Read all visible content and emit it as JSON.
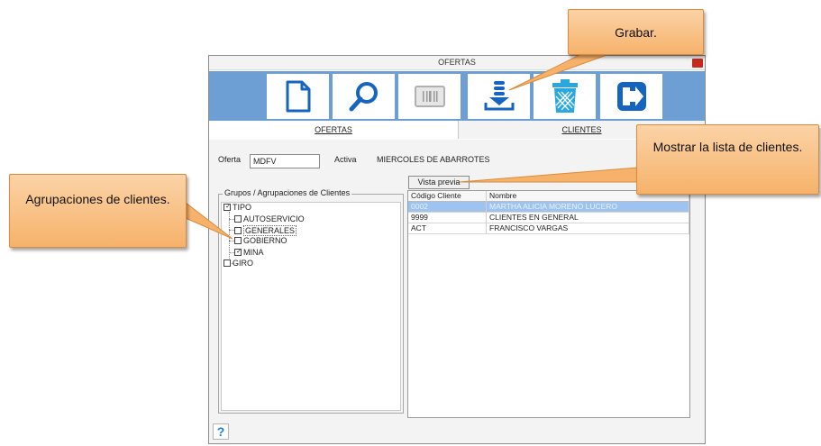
{
  "window": {
    "title": "OFERTAS"
  },
  "toolbar": {
    "buttons": [
      {
        "name": "new-document-icon"
      },
      {
        "name": "search-icon"
      },
      {
        "name": "barcode-icon"
      },
      {
        "name": "save-icon"
      },
      {
        "name": "delete-icon"
      },
      {
        "name": "exit-icon"
      }
    ]
  },
  "tabs": {
    "ofertas": "OFERTAS",
    "clientes": "CLIENTES"
  },
  "form": {
    "oferta_label": "Oferta",
    "oferta_value": "MDFV",
    "status": "Activa",
    "description": "MIERCOLES DE ABARROTES"
  },
  "groups": {
    "title": "Grupos / Agrupaciones de Clientes",
    "tipo": "TIPO",
    "autoservicio": "AUTOSERVICIO",
    "generales": "GENERALES",
    "gobierno": "GOBIERNO",
    "mina": "MINA",
    "giro": "GIRO"
  },
  "preview_button": "Vista previa",
  "table": {
    "headers": [
      "Código Cliente",
      "Nombre"
    ],
    "rows": [
      {
        "code": "0002",
        "name": "MARTHA ALICIA MORENO LUCERO"
      },
      {
        "code": "9999",
        "name": "CLIENTES EN GENERAL"
      },
      {
        "code": "ACT",
        "name": "FRANCISCO VARGAS"
      }
    ]
  },
  "help": "?",
  "callouts": {
    "save": "Grabar.",
    "list": "Mostrar la lista de clientes.",
    "groups": "Agrupaciones de clientes."
  }
}
